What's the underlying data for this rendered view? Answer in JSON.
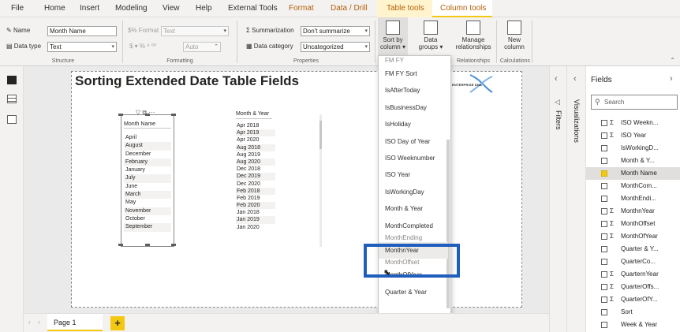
{
  "menu": {
    "file": "File",
    "home": "Home",
    "insert": "Insert",
    "modeling": "Modeling",
    "view": "View",
    "help": "Help",
    "external_tools": "External Tools",
    "format": "Format",
    "data_drill": "Data / Drill",
    "table_tools": "Table tools",
    "column_tools": "Column tools"
  },
  "ribbon": {
    "name_label": "Name",
    "name_value": "Month Name",
    "data_type_label": "Data type",
    "data_type_value": "Text",
    "format_label": "Format",
    "format_value": "Text",
    "auto_value": "Auto",
    "summarization_label": "Summarization",
    "summarization_value": "Don't summarize",
    "data_category_label": "Data category",
    "data_category_value": "Uncategorized",
    "sort_by_column_label": "Sort by column",
    "data_groups_label": "Data groups",
    "manage_relationships_label": "Manage relationships",
    "new_column_label": "New column",
    "groups": {
      "structure": "Structure",
      "formatting": "Formatting",
      "properties": "Properties",
      "relationships": "Relationships",
      "calculations": "Calculations"
    }
  },
  "report": {
    "title": "Sorting Extended Date Table Fields",
    "logo_text": "ENTERPRISE DNA",
    "slicer": {
      "header": "Month Name",
      "items": [
        "April",
        "August",
        "December",
        "February",
        "January",
        "July",
        "June",
        "March",
        "May",
        "November",
        "October",
        "September"
      ]
    },
    "table": {
      "header": "Month & Year",
      "items": [
        "Apr 2018",
        "Apr 2019",
        "Apr 2020",
        "Aug 2018",
        "Aug 2019",
        "Aug 2020",
        "Dec 2018",
        "Dec 2019",
        "Dec 2020",
        "Feb 2018",
        "Feb 2019",
        "Feb 2020",
        "Jan 2018",
        "Jan 2019",
        "Jan 2020"
      ]
    }
  },
  "dropdown": {
    "items": [
      {
        "label": "FM FY",
        "state": "clipped"
      },
      {
        "label": "FM FY Sort",
        "state": "normal"
      },
      {
        "label": "IsAfterToday",
        "state": "normal"
      },
      {
        "label": "IsBusinessDay",
        "state": "normal"
      },
      {
        "label": "IsHoliday",
        "state": "normal"
      },
      {
        "label": "ISO Day of Year",
        "state": "normal"
      },
      {
        "label": "ISO Weeknumber",
        "state": "normal"
      },
      {
        "label": "ISO Year",
        "state": "normal"
      },
      {
        "label": "IsWorkingDay",
        "state": "normal"
      },
      {
        "label": "Month & Year",
        "state": "normal"
      },
      {
        "label": "MonthCompleted",
        "state": "normal"
      },
      {
        "label": "MonthEnding",
        "state": "clipped"
      },
      {
        "label": "MonthnYear",
        "state": "hover"
      },
      {
        "label": "MonthOffset",
        "state": "clipped"
      },
      {
        "label": "MonthOfYear",
        "state": "normal"
      },
      {
        "label": "Quarter & Year",
        "state": "normal"
      }
    ]
  },
  "panes": {
    "filters": "Filters",
    "visualizations": "Visualizations",
    "fields_title": "Fields",
    "search_placeholder": "Search"
  },
  "fields": [
    {
      "name": "ISO Weekn...",
      "sigma": true,
      "checked": false,
      "selected": false
    },
    {
      "name": "ISO Year",
      "sigma": true,
      "checked": false,
      "selected": false
    },
    {
      "name": "IsWorkingD...",
      "sigma": false,
      "checked": false,
      "selected": false
    },
    {
      "name": "Month & Y...",
      "sigma": false,
      "checked": false,
      "selected": false
    },
    {
      "name": "Month Name",
      "sigma": false,
      "checked": true,
      "selected": true
    },
    {
      "name": "MonthCom...",
      "sigma": false,
      "checked": false,
      "selected": false
    },
    {
      "name": "MonthEndi...",
      "sigma": false,
      "checked": false,
      "selected": false
    },
    {
      "name": "MonthnYear",
      "sigma": true,
      "checked": false,
      "selected": false
    },
    {
      "name": "MonthOffset",
      "sigma": true,
      "checked": false,
      "selected": false
    },
    {
      "name": "MonthOfYear",
      "sigma": true,
      "checked": false,
      "selected": false
    },
    {
      "name": "Quarter & Y...",
      "sigma": false,
      "checked": false,
      "selected": false
    },
    {
      "name": "QuarterCo...",
      "sigma": false,
      "checked": false,
      "selected": false
    },
    {
      "name": "QuarternYear",
      "sigma": true,
      "checked": false,
      "selected": false
    },
    {
      "name": "QuarterOffs...",
      "sigma": true,
      "checked": false,
      "selected": false
    },
    {
      "name": "QuarterOfY...",
      "sigma": true,
      "checked": false,
      "selected": false
    },
    {
      "name": "Sort",
      "sigma": false,
      "checked": false,
      "selected": false
    },
    {
      "name": "Week & Year",
      "sigma": false,
      "checked": false,
      "selected": false
    }
  ],
  "bottom": {
    "page_tab": "Page 1",
    "add_page": "+"
  },
  "colors": {
    "accent": "#f2c811",
    "highlight_box": "#1f5ebd",
    "context_tab_text": "#b45f06"
  },
  "icons": {
    "report_view": "report-view-icon",
    "data_view": "data-view-icon",
    "model_view": "model-view-icon",
    "sort_by_column": "sort-by-column-icon",
    "search": "search-icon"
  }
}
